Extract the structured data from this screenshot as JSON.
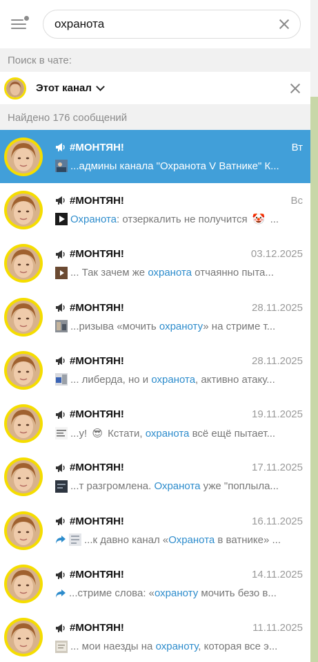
{
  "search": {
    "value": "охранота"
  },
  "chat_search_label": "Поиск в чате:",
  "scope": {
    "label": "Этот канал"
  },
  "found_label": "Найдено 176 сообщений",
  "results": [
    {
      "channel": "#МОНТЯН!",
      "date": "Вт",
      "active": true,
      "thumb": "video-thumb",
      "parts": [
        {
          "t": "...админы канала \"Охранота V Ватнике\" К..."
        }
      ]
    },
    {
      "channel": "#МОНТЯН!",
      "date": "Вс",
      "thumb": "play-thumb",
      "parts": [
        {
          "t": "Охранота",
          "hl": true
        },
        {
          "t": ": отзеркалить не получится "
        },
        {
          "emoji": "🤡"
        },
        {
          "t": " ..."
        }
      ]
    },
    {
      "channel": "#МОНТЯН!",
      "date": "03.12.2025",
      "thumb": "play-thumb-2",
      "parts": [
        {
          "t": "...  Так зачем же "
        },
        {
          "t": "охранота",
          "hl": true
        },
        {
          "t": " отчаянно пыта..."
        }
      ]
    },
    {
      "channel": "#МОНТЯН!",
      "date": "28.11.2025",
      "thumb": "photo-thumb",
      "parts": [
        {
          "t": "...ризыва «мочить "
        },
        {
          "t": "охраноту",
          "hl": true
        },
        {
          "t": "» на стриме т..."
        }
      ]
    },
    {
      "channel": "#МОНТЯН!",
      "date": "28.11.2025",
      "thumb": "photo-thumb-2",
      "parts": [
        {
          "t": "... либерда, но и "
        },
        {
          "t": "охранота",
          "hl": true
        },
        {
          "t": ", активно атаку..."
        }
      ]
    },
    {
      "channel": "#МОНТЯН!",
      "date": "19.11.2025",
      "thumb": "text-thumb",
      "parts": [
        {
          "t": "...у! "
        },
        {
          "emoji": "😎"
        },
        {
          "t": "  Кстати, "
        },
        {
          "t": "охранота",
          "hl": true
        },
        {
          "t": " всё ещё пытает..."
        }
      ]
    },
    {
      "channel": "#МОНТЯН!",
      "date": "17.11.2025",
      "thumb": "dark-thumb",
      "parts": [
        {
          "t": "...т разгромлена. "
        },
        {
          "t": "Охранота",
          "hl": true
        },
        {
          "t": " уже \"поплыла..."
        }
      ]
    },
    {
      "channel": "#МОНТЯН!",
      "date": "16.11.2025",
      "forward": true,
      "thumb": "doc-thumb",
      "parts": [
        {
          "t": "...к давно канал «"
        },
        {
          "t": "Охранота",
          "hl": true
        },
        {
          "t": " в ватнике» ..."
        }
      ]
    },
    {
      "channel": "#МОНТЯН!",
      "date": "14.11.2025",
      "forward": true,
      "parts": [
        {
          "t": "...стриме слова: «"
        },
        {
          "t": "охраноту",
          "hl": true
        },
        {
          "t": " мочить безо в..."
        }
      ]
    },
    {
      "channel": "#МОНТЯН!",
      "date": "11.11.2025",
      "thumb": "paper-thumb",
      "parts": [
        {
          "t": "... мои наезды на "
        },
        {
          "t": "охраноту",
          "hl": true
        },
        {
          "t": ", которая все э..."
        }
      ]
    }
  ],
  "colors": {
    "accent": "#419fd9",
    "highlight": "#2d8ccc",
    "avatar_ring": "#f5dd00"
  }
}
